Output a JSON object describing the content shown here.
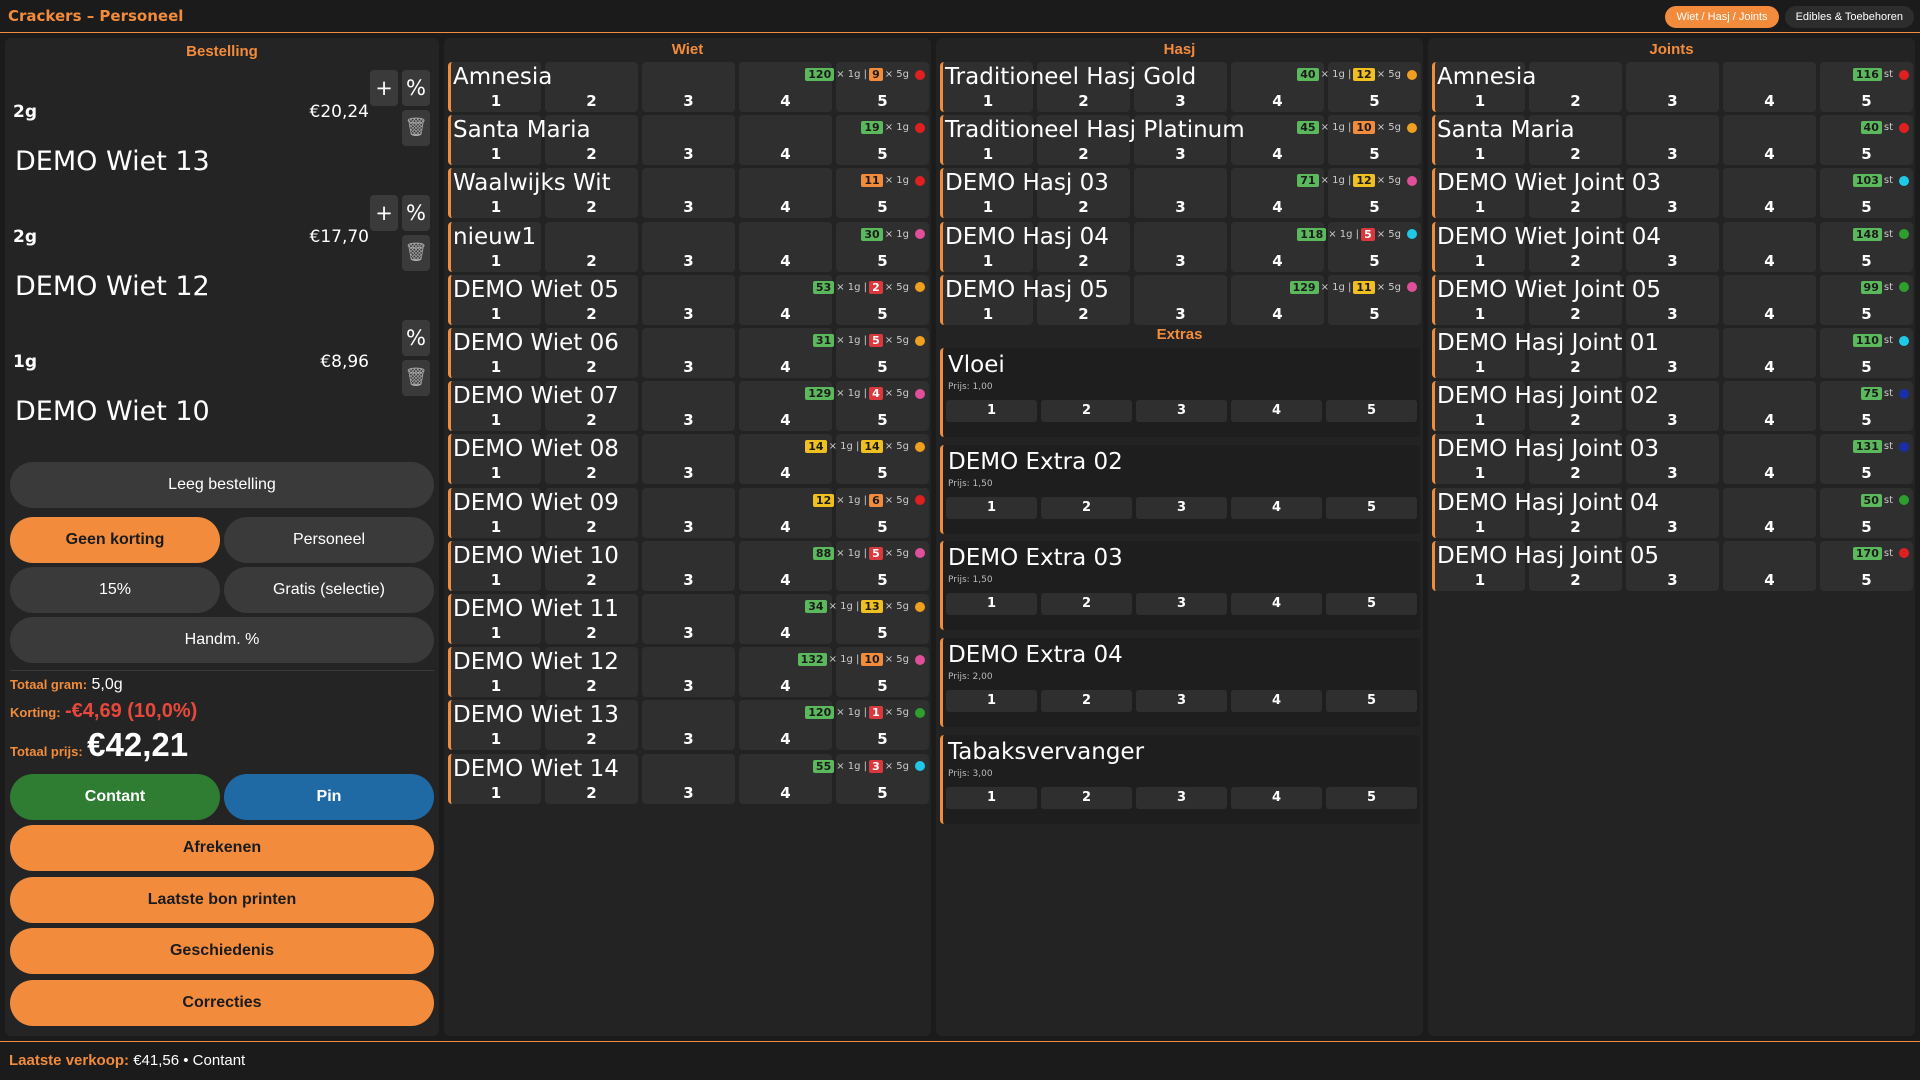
{
  "app": {
    "title": "Crackers – Personeel",
    "tabs": [
      "Wiet / Hasj / Joints",
      "Edibles & Toebehoren"
    ]
  },
  "order": {
    "title": "Bestelling",
    "items": [
      {
        "qty": "2g",
        "price": "€20,24",
        "name": "DEMO Wiet 13"
      },
      {
        "qty": "2g",
        "price": "€17,70",
        "name": "DEMO Wiet 12"
      },
      {
        "qty": "1g",
        "price": "€8,96",
        "name": "DEMO Wiet 10"
      }
    ],
    "plus_label": "+",
    "percent_label": "%",
    "trash_icon": "trash-icon",
    "clear_label": "Leeg bestelling",
    "discounts": [
      "Geen korting",
      "Personeel",
      "15%",
      "Gratis (selectie)",
      "Handm. %"
    ],
    "totals": {
      "grams_label": "Totaal gram:",
      "grams": "5,0g",
      "discount_label": "Korting:",
      "discount": "-€4,69 (10,0%)",
      "price_label": "Totaal prijs:",
      "price": "€42,21"
    },
    "pay": {
      "cash": "Contant",
      "pin": "Pin"
    },
    "actions": [
      "Afrekenen",
      "Laatste bon printen",
      "Geschiedenis",
      "Correcties"
    ]
  },
  "wiet": {
    "title": "Wiet",
    "rows": [
      {
        "name": "Amnesia",
        "stock": [
          [
            "120",
            "g",
            "× 1g |"
          ],
          [
            "9",
            "o",
            "× 5g"
          ]
        ],
        "dot": "#e02020"
      },
      {
        "name": "Santa Maria",
        "stock": [
          [
            "19",
            "g",
            "× 1g"
          ]
        ],
        "dot": "#e02020"
      },
      {
        "name": "Waalwijks Wit",
        "stock": [
          [
            "11",
            "o",
            "× 1g"
          ]
        ],
        "dot": "#e02020"
      },
      {
        "name": "nieuw1",
        "stock": [
          [
            "30",
            "g",
            "× 1g"
          ]
        ],
        "dot": "#e0509a"
      },
      {
        "name": "DEMO Wiet 05",
        "stock": [
          [
            "53",
            "g",
            "× 1g |"
          ],
          [
            "2",
            "r",
            "× 5g"
          ]
        ],
        "dot": "#f0a020"
      },
      {
        "name": "DEMO Wiet 06",
        "stock": [
          [
            "31",
            "g",
            "× 1g |"
          ],
          [
            "5",
            "r",
            "× 5g"
          ]
        ],
        "dot": "#f0a020"
      },
      {
        "name": "DEMO Wiet 07",
        "stock": [
          [
            "129",
            "g",
            "× 1g |"
          ],
          [
            "4",
            "r",
            "× 5g"
          ]
        ],
        "dot": "#e0509a"
      },
      {
        "name": "DEMO Wiet 08",
        "stock": [
          [
            "14",
            "y",
            "× 1g |"
          ],
          [
            "14",
            "y",
            "× 5g"
          ]
        ],
        "dot": "#f0a020"
      },
      {
        "name": "DEMO Wiet 09",
        "stock": [
          [
            "12",
            "y",
            "× 1g |"
          ],
          [
            "6",
            "o",
            "× 5g"
          ]
        ],
        "dot": "#e02020"
      },
      {
        "name": "DEMO Wiet 10",
        "stock": [
          [
            "88",
            "g",
            "× 1g |"
          ],
          [
            "5",
            "r",
            "× 5g"
          ]
        ],
        "dot": "#e0509a"
      },
      {
        "name": "DEMO Wiet 11",
        "stock": [
          [
            "34",
            "g",
            "× 1g |"
          ],
          [
            "13",
            "y",
            "× 5g"
          ]
        ],
        "dot": "#f0a020"
      },
      {
        "name": "DEMO Wiet 12",
        "stock": [
          [
            "132",
            "g",
            "× 1g |"
          ],
          [
            "10",
            "o",
            "× 5g"
          ]
        ],
        "dot": "#e0509a"
      },
      {
        "name": "DEMO Wiet 13",
        "stock": [
          [
            "120",
            "g",
            "× 1g |"
          ],
          [
            "1",
            "r",
            "× 5g"
          ]
        ],
        "dot": "#2e9e2e"
      },
      {
        "name": "DEMO Wiet 14",
        "stock": [
          [
            "55",
            "g",
            "× 1g |"
          ],
          [
            "3",
            "r",
            "× 5g"
          ]
        ],
        "dot": "#20c8e8"
      }
    ]
  },
  "hasj": {
    "title": "Hasj",
    "rows": [
      {
        "name": "Traditioneel Hasj Gold",
        "stock": [
          [
            "40",
            "g",
            "× 1g |"
          ],
          [
            "12",
            "y",
            "× 5g"
          ]
        ],
        "dot": "#f0a020"
      },
      {
        "name": "Traditioneel Hasj Platinum",
        "stock": [
          [
            "45",
            "g",
            "× 1g |"
          ],
          [
            "10",
            "o",
            "× 5g"
          ]
        ],
        "dot": "#f0a020"
      },
      {
        "name": "DEMO Hasj 03",
        "stock": [
          [
            "71",
            "g",
            "× 1g |"
          ],
          [
            "12",
            "y",
            "× 5g"
          ]
        ],
        "dot": "#e0509a"
      },
      {
        "name": "DEMO Hasj 04",
        "stock": [
          [
            "118",
            "g",
            "× 1g |"
          ],
          [
            "5",
            "r",
            "× 5g"
          ]
        ],
        "dot": "#20c8e8"
      },
      {
        "name": "DEMO Hasj 05",
        "stock": [
          [
            "129",
            "g",
            "× 1g |"
          ],
          [
            "11",
            "y",
            "× 5g"
          ]
        ],
        "dot": "#e0509a"
      }
    ]
  },
  "extras": {
    "title": "Extras",
    "items": [
      {
        "name": "Vloei",
        "price": "Prijs: 1,00"
      },
      {
        "name": "DEMO Extra 02",
        "price": "Prijs: 1,50"
      },
      {
        "name": "DEMO Extra 03",
        "price": "Prijs: 1,50"
      },
      {
        "name": "DEMO Extra 04",
        "price": "Prijs: 2,00"
      },
      {
        "name": "Tabaksvervanger",
        "price": "Prijs: 3,00"
      }
    ]
  },
  "joints": {
    "title": "Joints",
    "rows": [
      {
        "name": "Amnesia",
        "stock": [
          [
            "116",
            "g",
            "st"
          ]
        ],
        "dot": "#e02020"
      },
      {
        "name": "Santa Maria",
        "stock": [
          [
            "40",
            "g",
            "st"
          ]
        ],
        "dot": "#e02020"
      },
      {
        "name": "DEMO Wiet Joint 03",
        "stock": [
          [
            "103",
            "g",
            "st"
          ]
        ],
        "dot": "#20c8e8"
      },
      {
        "name": "DEMO Wiet Joint 04",
        "stock": [
          [
            "148",
            "g",
            "st"
          ]
        ],
        "dot": "#2e9e2e"
      },
      {
        "name": "DEMO Wiet Joint 05",
        "stock": [
          [
            "99",
            "g",
            "st"
          ]
        ],
        "dot": "#2e9e2e"
      },
      {
        "name": "DEMO Hasj Joint 01",
        "stock": [
          [
            "110",
            "g",
            "st"
          ]
        ],
        "dot": "#20c8e8"
      },
      {
        "name": "DEMO Hasj Joint 02",
        "stock": [
          [
            "75",
            "g",
            "st"
          ]
        ],
        "dot": "#1a2ea8"
      },
      {
        "name": "DEMO Hasj Joint 03",
        "stock": [
          [
            "131",
            "g",
            "st"
          ]
        ],
        "dot": "#1a2ea8"
      },
      {
        "name": "DEMO Hasj Joint 04",
        "stock": [
          [
            "50",
            "g",
            "st"
          ]
        ],
        "dot": "#2e9e2e"
      },
      {
        "name": "DEMO Hasj Joint 05",
        "stock": [
          [
            "170",
            "g",
            "st"
          ]
        ],
        "dot": "#e02020"
      }
    ]
  },
  "qty_buttons": [
    "1",
    "2",
    "3",
    "4",
    "5"
  ],
  "status": {
    "label": "Laatste verkoop:",
    "text": "€41,56 • Contant"
  }
}
